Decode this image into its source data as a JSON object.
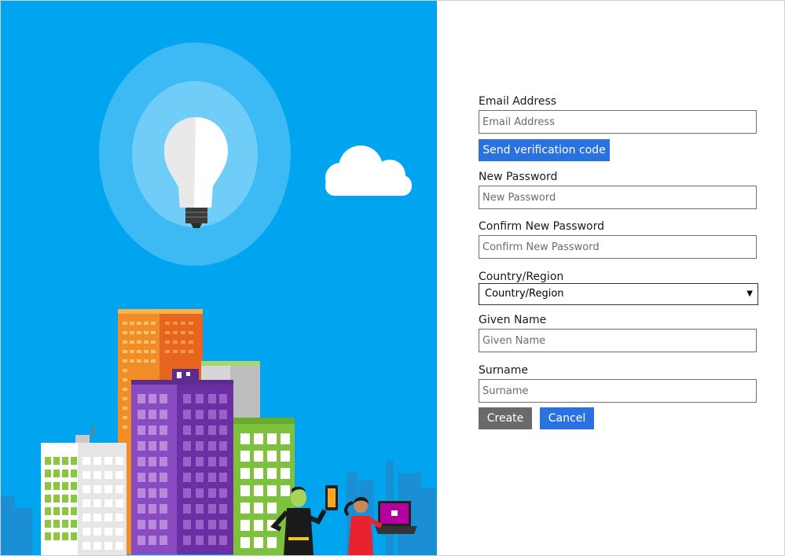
{
  "form": {
    "email": {
      "label": "Email Address",
      "placeholder": "Email Address"
    },
    "send_code_label": "Send verification code",
    "new_password": {
      "label": "New Password",
      "placeholder": "New Password"
    },
    "confirm_password": {
      "label": "Confirm New Password",
      "placeholder": "Confirm New Password"
    },
    "country": {
      "label": "Country/Region",
      "selected": "Country/Region"
    },
    "given_name": {
      "label": "Given Name",
      "placeholder": "Given Name"
    },
    "surname": {
      "label": "Surname",
      "placeholder": "Surname"
    },
    "create_label": "Create",
    "cancel_label": "Cancel"
  },
  "colors": {
    "sky": "#00a4ef",
    "accent_blue": "#2a72e0",
    "gray_button": "#6a6a6a"
  },
  "illustration": {
    "icons": [
      "lightbulb-icon",
      "cloud-icon",
      "city-skyline",
      "person-with-phone",
      "person-with-laptop"
    ]
  }
}
